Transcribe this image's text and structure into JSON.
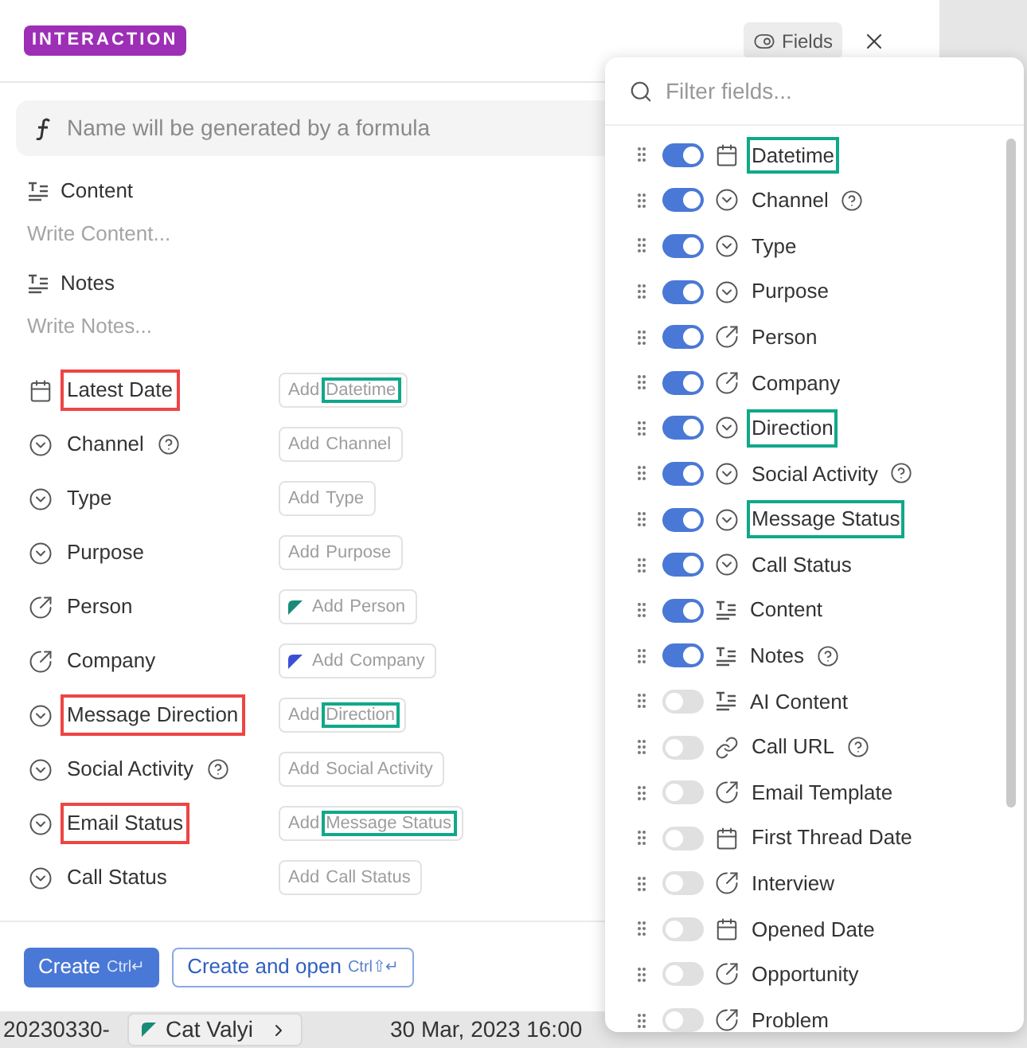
{
  "dialog": {
    "badge": "INTERACTION",
    "fields_button": "Fields",
    "name_placeholder": "Name will be generated by a formula",
    "text_fields": [
      {
        "label": "Content",
        "placeholder": "Write Content..."
      },
      {
        "label": "Notes",
        "placeholder": "Write Notes..."
      }
    ],
    "properties": [
      {
        "kind": "date",
        "label": "Latest Date",
        "help": false,
        "label_highlight": {
          "color": "#ef4444"
        },
        "add": "Add",
        "name": "Datetime",
        "name_highlight": {
          "color": "#10a88a"
        }
      },
      {
        "kind": "select",
        "label": "Channel",
        "help": true,
        "add": "Add",
        "name": "Channel"
      },
      {
        "kind": "select",
        "label": "Type",
        "help": false,
        "add": "Add",
        "name": "Type"
      },
      {
        "kind": "select",
        "label": "Purpose",
        "help": false,
        "add": "Add",
        "name": "Purpose"
      },
      {
        "kind": "relation",
        "label": "Person",
        "help": false,
        "add": "Add",
        "name": "Person",
        "color": "#1a8a78"
      },
      {
        "kind": "relation",
        "label": "Company",
        "help": false,
        "add": "Add",
        "name": "Company",
        "color": "#3b4fd6"
      },
      {
        "kind": "select",
        "label": "Message Direction",
        "help": false,
        "label_highlight": {
          "color": "#ef4444"
        },
        "add": "Add",
        "name": "Direction",
        "name_highlight": {
          "color": "#10a88a"
        }
      },
      {
        "kind": "select",
        "label": "Social Activity",
        "help": true,
        "add": "Add",
        "name": "Social Activity"
      },
      {
        "kind": "select",
        "label": "Email Status",
        "help": false,
        "label_highlight": {
          "color": "#ef4444"
        },
        "add": "Add",
        "name": "Message Status",
        "name_highlight": {
          "color": "#10a88a"
        }
      },
      {
        "kind": "select",
        "label": "Call Status",
        "help": false,
        "add": "Add",
        "name": "Call Status"
      }
    ],
    "buttons": [
      {
        "kind": "primary",
        "label": "Create",
        "shortcut": "Ctrl↵"
      },
      {
        "kind": "secondary",
        "label": "Create and open",
        "shortcut": "Ctrl⇧↵"
      }
    ]
  },
  "background_row": {
    "id": "20230330-",
    "person": "Cat Valyi",
    "person_mark": {
      "color": "#1a8a78"
    },
    "date": "30 Mar, 2023 16:00"
  },
  "fields_popover": {
    "search_placeholder": "Filter fields...",
    "items": [
      {
        "kind": "date",
        "label": "Datetime",
        "on": true,
        "help": false,
        "highlight": {
          "color": "#10a88a"
        }
      },
      {
        "kind": "select",
        "label": "Channel",
        "on": true,
        "help": true
      },
      {
        "kind": "select",
        "label": "Type",
        "on": true,
        "help": false
      },
      {
        "kind": "select",
        "label": "Purpose",
        "on": true,
        "help": false
      },
      {
        "kind": "relation",
        "label": "Person",
        "on": true,
        "help": false
      },
      {
        "kind": "relation",
        "label": "Company",
        "on": true,
        "help": false
      },
      {
        "kind": "select",
        "label": "Direction",
        "on": true,
        "help": false,
        "highlight": {
          "color": "#10a88a"
        }
      },
      {
        "kind": "select",
        "label": "Social Activity",
        "on": true,
        "help": true
      },
      {
        "kind": "select",
        "label": "Message Status",
        "on": true,
        "help": false,
        "highlight": {
          "color": "#10a88a"
        }
      },
      {
        "kind": "select",
        "label": "Call Status",
        "on": true,
        "help": false
      },
      {
        "kind": "text",
        "label": "Content",
        "on": true,
        "help": false
      },
      {
        "kind": "text",
        "label": "Notes",
        "on": true,
        "help": true
      },
      {
        "kind": "text",
        "label": "AI Content",
        "on": false,
        "help": false
      },
      {
        "kind": "link",
        "label": "Call URL",
        "on": false,
        "help": true
      },
      {
        "kind": "relation",
        "label": "Email Template",
        "on": false,
        "help": false
      },
      {
        "kind": "date",
        "label": "First Thread Date",
        "on": false,
        "help": false
      },
      {
        "kind": "relation",
        "label": "Interview",
        "on": false,
        "help": false
      },
      {
        "kind": "date",
        "label": "Opened Date",
        "on": false,
        "help": false
      },
      {
        "kind": "relation",
        "label": "Opportunity",
        "on": false,
        "help": false
      },
      {
        "kind": "relation",
        "label": "Problem",
        "on": false,
        "help": false
      }
    ]
  }
}
